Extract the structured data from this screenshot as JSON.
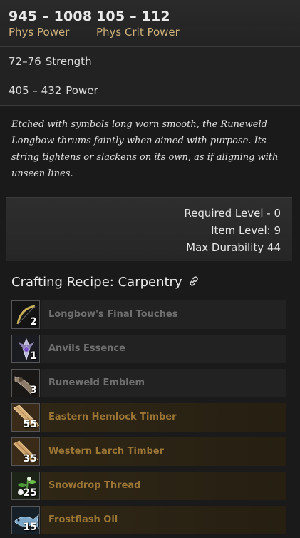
{
  "stats": {
    "primary": [
      {
        "value": "945 – 1008",
        "label": "Phys Power"
      },
      {
        "value": "105 – 112",
        "label": "Phys Crit Power"
      }
    ],
    "rows": [
      {
        "value": "72–76",
        "label": "Strength"
      },
      {
        "value": "405 – 432",
        "label": "Power"
      }
    ]
  },
  "description": "Etched with symbols long worn smooth, the Runeweld Longbow thrums faintly when aimed with purpose. Its string tightens or slackens on its own, as if aligning with unseen lines.",
  "requirements": {
    "required_level": "Required Level - 0",
    "item_level": "Item Level: 9",
    "max_durability": "Max Durability 44"
  },
  "recipe": {
    "title": "Crafting Recipe: Carpentry",
    "link_icon": "link-icon",
    "ingredients": [
      {
        "name": "Longbow's Final Touches",
        "count": "2",
        "icon": "bow-icon",
        "owned": false
      },
      {
        "name": "Anvils Essence",
        "count": "1",
        "icon": "crystal-icon",
        "owned": false
      },
      {
        "name": "Runeweld Emblem",
        "count": "3",
        "icon": "emblem-icon",
        "owned": false
      },
      {
        "name": "Eastern Hemlock Timber",
        "count": "55",
        "icon": "timber-icon",
        "owned": true
      },
      {
        "name": "Western Larch Timber",
        "count": "35",
        "icon": "timber-icon",
        "owned": true
      },
      {
        "name": "Snowdrop Thread",
        "count": "25",
        "icon": "flower-icon",
        "owned": true
      },
      {
        "name": "Frostflash Oil",
        "count": "15",
        "icon": "fish-icon",
        "owned": true
      }
    ]
  },
  "colors": {
    "accent_label": "#cdb07b",
    "owned_text": "#9a7536",
    "missing_text": "#6f6f6f"
  }
}
